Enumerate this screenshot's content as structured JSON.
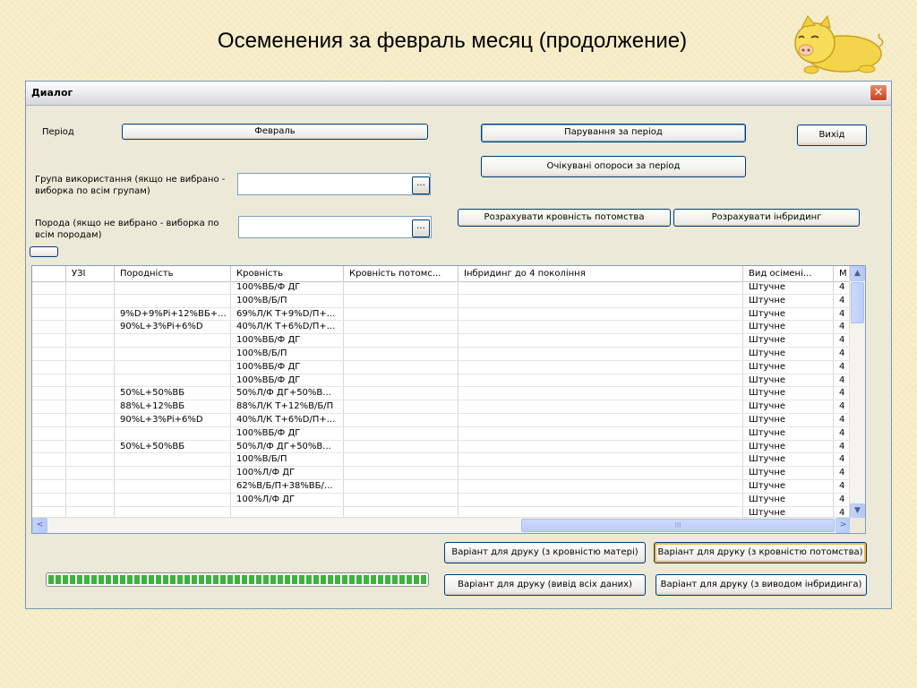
{
  "slide": {
    "title": "Осеменения за февраль месяц (продолжение)"
  },
  "dialog": {
    "title": "Диалог",
    "close_glyph": "✕",
    "period_label": "Період",
    "period_value": "Февраль",
    "group_label_line1": "Група використання (якщо не вибрано -",
    "group_label_line2": "виборка по всім групам)",
    "breed_label_line1": "Порода (якщо не вибрано - виборка по",
    "breed_label_line2": "всім породам)",
    "group_value": "",
    "breed_value": "",
    "ellipsis": "...",
    "btn_pairings": "Парування за період",
    "btn_exit": "Вихід",
    "btn_expected": "Очікувані опороси за період",
    "btn_calc_blood": "Розрахувати кровність потомства",
    "btn_calc_inbreeding": "Розрахувати інбридинг",
    "btn_print_mother": "Варіант для друку (з кровністю матері)",
    "btn_print_offspring": "Варіант для друку (з кровністю потомства)",
    "btn_print_all": "Варіант для друку (вивід всіх даних)",
    "btn_print_inbreeding": "Варіант для друку (з виводом інбридинга)",
    "progress_fraction": 1.0
  },
  "grid": {
    "columns": [
      "",
      "УЗІ",
      "Породність",
      "Кровність",
      "Кровність потомс...",
      "Інбридинг до 4 покоління",
      "Вид осімені...",
      "М"
    ],
    "rows": [
      [
        "",
        "",
        "",
        "100%ВБ/Ф ДГ",
        "",
        "",
        "Штучне",
        "4"
      ],
      [
        "",
        "",
        "",
        "100%В/Б/П",
        "",
        "",
        "Штучне",
        "4"
      ],
      [
        "",
        "",
        "9%D+9%Pi+12%ВБ+...",
        "69%Л/К Т+9%D/П+...",
        "",
        "",
        "Штучне",
        "4"
      ],
      [
        "",
        "",
        "90%L+3%Pi+6%D",
        "40%Л/К Т+6%D/П+...",
        "",
        "",
        "Штучне",
        "4"
      ],
      [
        "",
        "",
        "",
        "100%ВБ/Ф ДГ",
        "",
        "",
        "Штучне",
        "4"
      ],
      [
        "",
        "",
        "",
        "100%В/Б/П",
        "",
        "",
        "Штучне",
        "4"
      ],
      [
        "",
        "",
        "",
        "100%ВБ/Ф ДГ",
        "",
        "",
        "Штучне",
        "4"
      ],
      [
        "",
        "",
        "",
        "100%ВБ/Ф ДГ",
        "",
        "",
        "Штучне",
        "4"
      ],
      [
        "",
        "",
        "50%L+50%ВБ",
        "50%Л/Ф ДГ+50%В...",
        "",
        "",
        "Штучне",
        "4"
      ],
      [
        "",
        "",
        "88%L+12%ВБ",
        "88%Л/К Т+12%В/Б/П",
        "",
        "",
        "Штучне",
        "4"
      ],
      [
        "",
        "",
        "90%L+3%Pi+6%D",
        "40%Л/К Т+6%D/П+...",
        "",
        "",
        "Штучне",
        "4"
      ],
      [
        "",
        "",
        "",
        "100%ВБ/Ф ДГ",
        "",
        "",
        "Штучне",
        "4"
      ],
      [
        "",
        "",
        "50%L+50%ВБ",
        "50%Л/Ф ДГ+50%В...",
        "",
        "",
        "Штучне",
        "4"
      ],
      [
        "",
        "",
        "",
        "100%В/Б/П",
        "",
        "",
        "Штучне",
        "4"
      ],
      [
        "",
        "",
        "",
        "100%Л/Ф ДГ",
        "",
        "",
        "Штучне",
        "4"
      ],
      [
        "",
        "",
        "",
        "62%В/Б/П+38%ВБ/...",
        "",
        "",
        "Штучне",
        "4"
      ],
      [
        "",
        "",
        "",
        "100%Л/Ф ДГ",
        "",
        "",
        "Штучне",
        "4"
      ],
      [
        "",
        "",
        "",
        "",
        "",
        "",
        "Штучне",
        "4"
      ]
    ],
    "scroll_up": "▲",
    "scroll_down": "▼",
    "scroll_left": "<",
    "scroll_right": ">",
    "hthumb_grip": "III"
  },
  "colors": {
    "background": "#f6ecc6",
    "progress": "#3cb43c",
    "close": "#c8411c"
  }
}
